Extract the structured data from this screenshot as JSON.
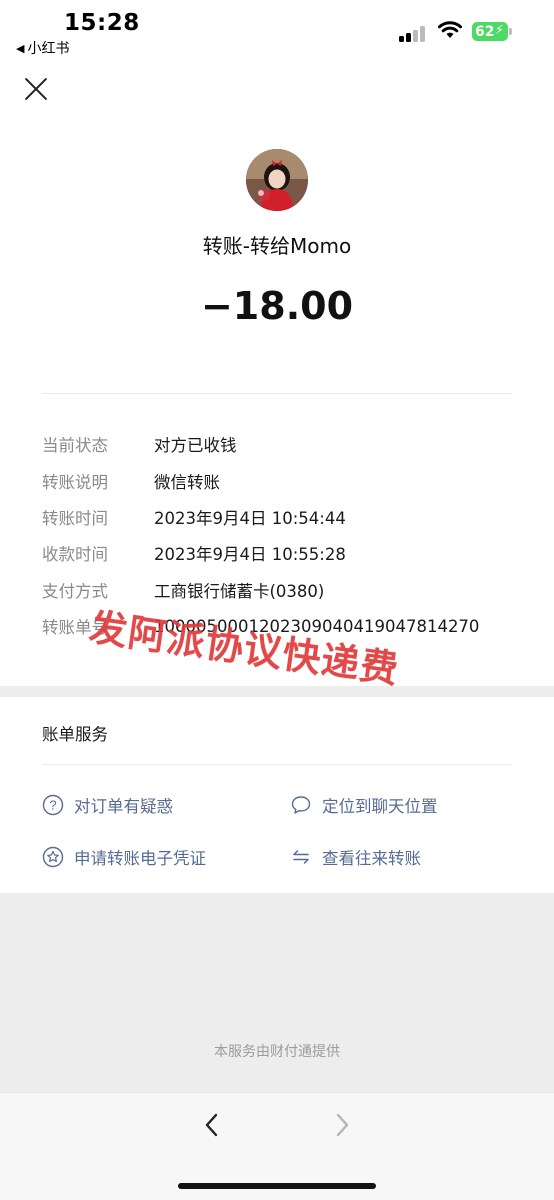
{
  "status_bar": {
    "time": "15:28",
    "back_app_label": "小红书",
    "battery_level": "62",
    "icons": [
      "signal-icon",
      "wifi-icon",
      "battery-icon"
    ]
  },
  "header": {
    "close_icon": "close-icon"
  },
  "transfer": {
    "title": "转账-转给Momo",
    "amount": "−18.00"
  },
  "details": [
    {
      "label": "当前状态",
      "value": "对方已收钱"
    },
    {
      "label": "转账说明",
      "value": "微信转账"
    },
    {
      "label": "转账时间",
      "value": "2023年9月4日 10:54:44"
    },
    {
      "label": "收款时间",
      "value": "2023年9月4日 10:55:28"
    },
    {
      "label": "支付方式",
      "value": "工商银行储蓄卡(0380)"
    },
    {
      "label": "转账单号",
      "value": "10000500012023090404190478142​70"
    }
  ],
  "watermark": "发阿派协议快递费",
  "services": {
    "title": "账单服务",
    "links": [
      {
        "label": "对订单有疑惑",
        "icon": "question-circle-icon"
      },
      {
        "label": "定位到聊天位置",
        "icon": "chat-bubble-icon"
      },
      {
        "label": "申请转账电子凭证",
        "icon": "star-badge-icon"
      },
      {
        "label": "查看往来转账",
        "icon": "transfer-arrows-icon"
      }
    ]
  },
  "footer": {
    "provider": "本服务由财付通提供"
  },
  "colors": {
    "link": "#576b95",
    "watermark": "#e23a3a",
    "battery": "#4cd964"
  }
}
